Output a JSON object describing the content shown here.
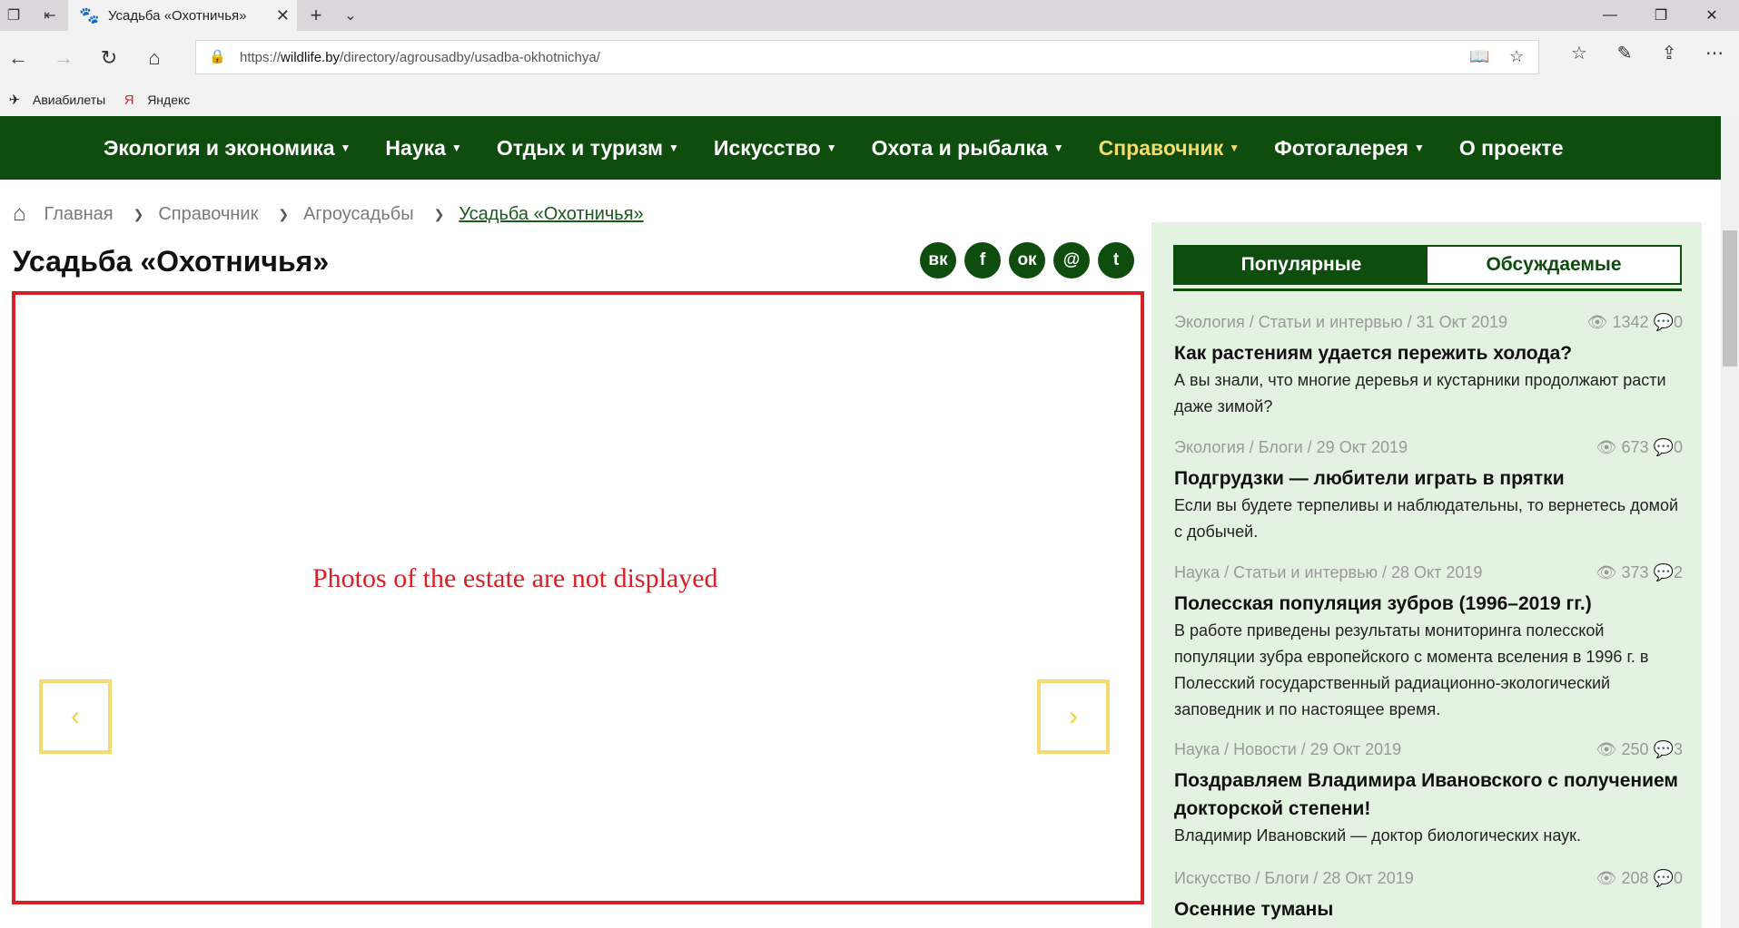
{
  "browser": {
    "tab_title": "Усадьба «Охотничья»",
    "url_scheme": "https://",
    "url_host": "wildlife.by",
    "url_path": "/directory/agrousadby/usadba-okhotnichya/",
    "favorites": [
      {
        "label": "Авиабилеты",
        "icon": "airplane-icon"
      },
      {
        "label": "Яндекс",
        "icon": "yandex-icon"
      }
    ]
  },
  "nav": {
    "items": [
      {
        "label": "Экология и экономика"
      },
      {
        "label": "Наука"
      },
      {
        "label": "Отдых и туризм"
      },
      {
        "label": "Искусство"
      },
      {
        "label": "Охота и рыбалка"
      },
      {
        "label": "Справочник",
        "active": true
      },
      {
        "label": "Фотогалерея"
      },
      {
        "label": "О проекте"
      }
    ]
  },
  "breadcrumb": [
    "Главная",
    "Справочник",
    "Агроусадьбы",
    "Усадьба «Охотничья»"
  ],
  "page_title": "Усадьба «Охотничья»",
  "share_icons": [
    "vk-icon",
    "facebook-icon",
    "odnoklassniki-icon",
    "mail-icon",
    "twitter-icon"
  ],
  "gallery": {
    "message": "Photos of the estate are not displayed",
    "border_color": "#d81f26"
  },
  "sidebar": {
    "tabs": [
      "Популярные",
      "Обсуждаемые"
    ],
    "posts": [
      {
        "meta": "Экология / Статьи и интервью / 31 Окт 2019",
        "views": "1342",
        "comments": "0",
        "title": "Как растениям удается пережить холода?",
        "text": "А вы знали, что многие деревья и кустарники продолжают расти даже зимой?"
      },
      {
        "meta": "Экология / Блоги / 29 Окт 2019",
        "views": "673",
        "comments": "0",
        "title": "Подгрудзки — любители играть в прятки",
        "text": "Если вы будете терпеливы и наблюдательны, то вернетесь домой с добычей."
      },
      {
        "meta": "Наука / Статьи и интервью / 28 Окт 2019",
        "views": "373",
        "comments": "2",
        "title": "Полесская популяция зубров (1996–2019 гг.)",
        "text": "В работе приведены результаты мониторинга полесской популяции зубра европейского с момента вселения в 1996 г. в Полесский государственный радиационно-экологический заповедник и по настоящее время."
      },
      {
        "meta": "Наука / Новости / 29 Окт 2019",
        "views": "250",
        "comments": "3",
        "title": "Поздравляем Владимира Ивановского с получением докторской степени!",
        "text": "Владимир Ивановский — доктор биологических наук."
      },
      {
        "meta": "Искусство / Блоги / 28 Окт 2019",
        "views": "208",
        "comments": "0",
        "title": "Осенние туманы",
        "text": ""
      }
    ]
  },
  "colors": {
    "brand_green": "#0f4d0f",
    "active_nav": "#f5dc6a",
    "sidebar_bg": "#e4f2e1",
    "arrow_yellow": "#f4dc70"
  }
}
